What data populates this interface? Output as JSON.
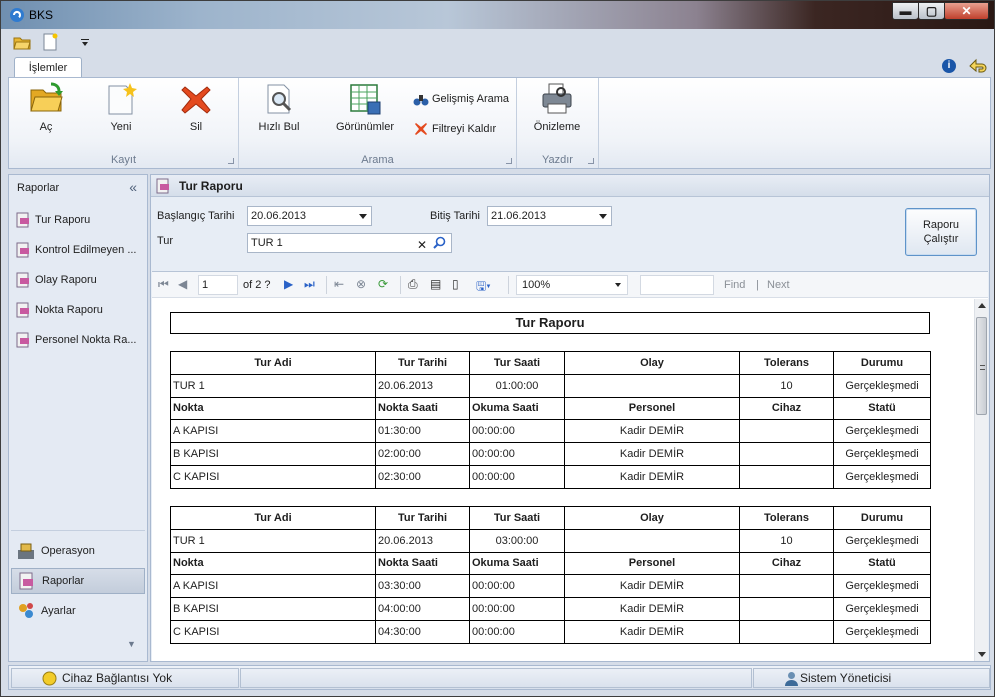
{
  "window": {
    "title": "BKS"
  },
  "ribbon": {
    "tab_label": "İşlemler",
    "groups": {
      "kayit": {
        "label": "Kayıt",
        "buttons": {
          "ac": "Aç",
          "yeni": "Yeni",
          "sil": "Sil"
        }
      },
      "arama": {
        "label": "Arama",
        "buttons": {
          "hizli_bul": "Hızlı Bul",
          "gorunumler": "Görünümler",
          "gelismis_arama": "Gelişmiş Arama",
          "filtreyi_kaldir": "Filtreyi Kaldır"
        }
      },
      "yazdir": {
        "label": "Yazdır",
        "buttons": {
          "onizleme": "Önizleme"
        }
      }
    }
  },
  "sidebar": {
    "header": "Raporlar",
    "collapse_glyph": "«",
    "items": [
      {
        "label": "Tur Raporu"
      },
      {
        "label": "Kontrol Edilmeyen ..."
      },
      {
        "label": "Olay Raporu"
      },
      {
        "label": "Nokta Raporu"
      },
      {
        "label": "Personel Nokta Ra..."
      }
    ],
    "nav": {
      "operasyon": "Operasyon",
      "raporlar": "Raporlar",
      "ayarlar": "Ayarlar"
    }
  },
  "main": {
    "title": "Tur Raporu",
    "form": {
      "start_date_label": "Başlangıç Tarihi",
      "start_date_value": "20.06.2013",
      "end_date_label": "Bitiş Tarihi",
      "end_date_value": "21.06.2013",
      "tour_label": "Tur",
      "tour_value": "TUR 1",
      "run_button_line1": "Raporu",
      "run_button_line2": "Çalıştır"
    }
  },
  "viewer": {
    "page_current": "1",
    "page_of": "of  2 ?",
    "zoom": "100%",
    "find_label": "Find",
    "find_sep": "|",
    "next_label": "Next"
  },
  "report": {
    "title": "Tur Raporu",
    "tour_headers": [
      "Tur Adi",
      "Tur Tarihi",
      "Tur Saati",
      "Olay",
      "Tolerans",
      "Durumu"
    ],
    "point_headers": [
      "Nokta",
      "Nokta Saati",
      "Okuma Saati",
      "Personel",
      "Cihaz",
      "Statü"
    ],
    "tours": [
      {
        "row": [
          "TUR 1",
          "20.06.2013",
          "01:00:00",
          "",
          "10",
          "Gerçekleşmedi"
        ],
        "points": [
          [
            "A KAPISI",
            "01:30:00",
            "00:00:00",
            "Kadir DEMİR",
            "",
            "Gerçekleşmedi"
          ],
          [
            "B KAPISI",
            "02:00:00",
            "00:00:00",
            "Kadir DEMİR",
            "",
            "Gerçekleşmedi"
          ],
          [
            "C KAPISI",
            "02:30:00",
            "00:00:00",
            "Kadir DEMİR",
            "",
            "Gerçekleşmedi"
          ]
        ]
      },
      {
        "row": [
          "TUR 1",
          "20.06.2013",
          "03:00:00",
          "",
          "10",
          "Gerçekleşmedi"
        ],
        "points": [
          [
            "A KAPISI",
            "03:30:00",
            "00:00:00",
            "Kadir DEMİR",
            "",
            "Gerçekleşmedi"
          ],
          [
            "B KAPISI",
            "04:00:00",
            "00:00:00",
            "Kadir DEMİR",
            "",
            "Gerçekleşmedi"
          ],
          [
            "C KAPISI",
            "04:30:00",
            "00:00:00",
            "Kadir DEMİR",
            "",
            "Gerçekleşmedi"
          ]
        ]
      }
    ]
  },
  "statusbar": {
    "connection": "Cihaz Bağlantısı Yok",
    "user": "Sistem Yöneticisi"
  },
  "colors": {
    "accent": "#5e93c9",
    "ribbon_bg": "#f0f3f8",
    "panel_bg": "#e4eaf3"
  }
}
